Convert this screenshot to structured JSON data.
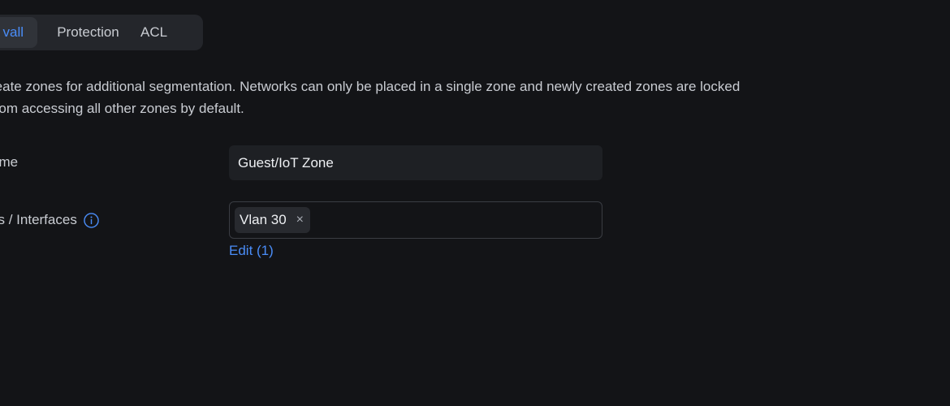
{
  "tabs": {
    "items": [
      {
        "label": "vall",
        "active": true
      },
      {
        "label": "Protection",
        "active": false
      },
      {
        "label": "ACL",
        "active": false
      }
    ]
  },
  "description": "reate zones for additional segmentation. Networks can only be placed in a single zone and newly created zones are locked from accessing all other zones by default.",
  "form": {
    "name_label": "ame",
    "name_value": "Guest/IoT Zone",
    "networks_label": "ks / Interfaces",
    "info_icon": "info-icon",
    "chips": [
      {
        "label": "Vlan 30",
        "remove_icon": "×"
      }
    ],
    "edit_link": "Edit (1)"
  },
  "colors": {
    "background": "#131417",
    "accent": "#4a8df8",
    "tab_bar": "#24262b",
    "input_bg": "#1e2024"
  }
}
